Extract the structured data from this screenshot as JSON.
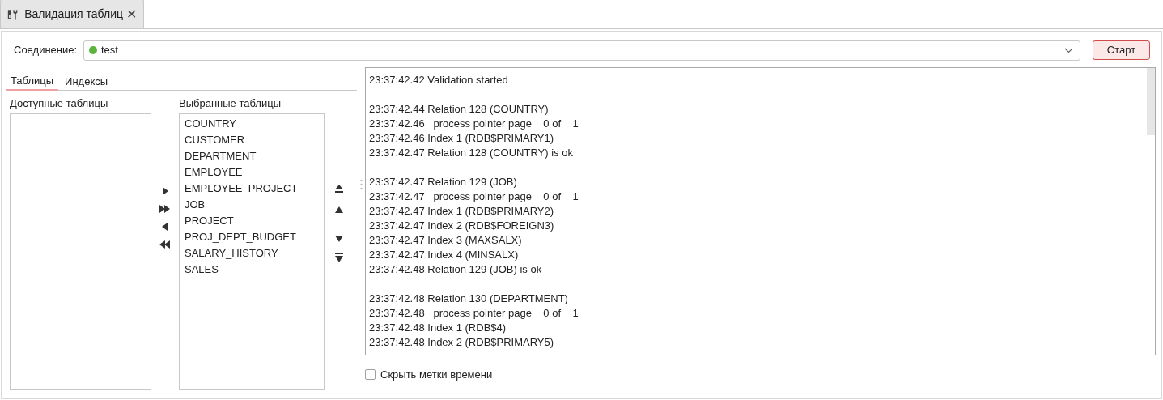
{
  "tab": {
    "title": "Валидация таблиц",
    "close": "✕"
  },
  "connection": {
    "label": "Соединение:",
    "value": "test",
    "color": "#5cb33f"
  },
  "start_button": "Старт",
  "subtabs": [
    {
      "label": "Таблицы",
      "selected": true
    },
    {
      "label": "Индексы",
      "selected": false
    }
  ],
  "available": {
    "title": "Доступные таблицы"
  },
  "chosen": {
    "title": "Выбранные таблицы",
    "items": [
      "COUNTRY",
      "CUSTOMER",
      "DEPARTMENT",
      "EMPLOYEE",
      "EMPLOYEE_PROJECT",
      "JOB",
      "PROJECT",
      "PROJ_DEPT_BUDGET",
      "SALARY_HISTORY",
      "SALES"
    ]
  },
  "log": [
    [
      "23:37:42.42 Validation started"
    ],
    [
      "23:37:42.44 Relation 128 (COUNTRY)",
      "23:37:42.46   process pointer page    0 of    1",
      "23:37:42.46 Index 1 (RDB$PRIMARY1)",
      "23:37:42.47 Relation 128 (COUNTRY) is ok"
    ],
    [
      "23:37:42.47 Relation 129 (JOB)",
      "23:37:42.47   process pointer page    0 of    1",
      "23:37:42.47 Index 1 (RDB$PRIMARY2)",
      "23:37:42.47 Index 2 (RDB$FOREIGN3)",
      "23:37:42.47 Index 3 (MAXSALX)",
      "23:37:42.47 Index 4 (MINSALX)",
      "23:37:42.48 Relation 129 (JOB) is ok"
    ],
    [
      "23:37:42.48 Relation 130 (DEPARTMENT)",
      "23:37:42.48   process pointer page    0 of    1",
      "23:37:42.48 Index 1 (RDB$4)",
      "23:37:42.48 Index 2 (RDB$PRIMARY5)"
    ]
  ],
  "hide_timestamps": {
    "label": "Скрыть метки времени",
    "checked": false
  }
}
